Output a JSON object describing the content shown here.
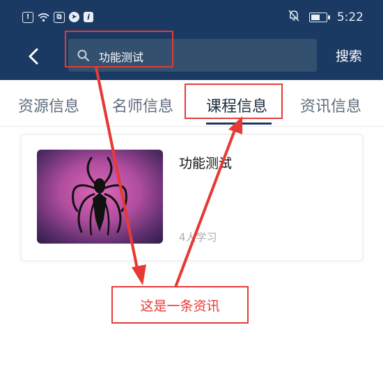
{
  "status_bar": {
    "time": "5:22",
    "icons": [
      "sim-icon",
      "wifi-icon",
      "app-icon",
      "telegram-icon",
      "info-icon",
      "mute-icon",
      "battery-icon"
    ],
    "battery_level": 0.6
  },
  "nav": {
    "search_value": "功能测试",
    "search_button": "搜索"
  },
  "tabs": [
    {
      "label": "资源信息",
      "active": false
    },
    {
      "label": "名师信息",
      "active": false
    },
    {
      "label": "课程信息",
      "active": true
    },
    {
      "label": "资讯信息",
      "active": false
    }
  ],
  "course": {
    "title": "功能测试",
    "learners": "4人学习"
  },
  "annotation": {
    "label": "这是一条资讯",
    "color": "#e53a35"
  },
  "colors": {
    "header": "#1a3a63",
    "search_bg": "#33506f",
    "accent": "#e53a35"
  }
}
